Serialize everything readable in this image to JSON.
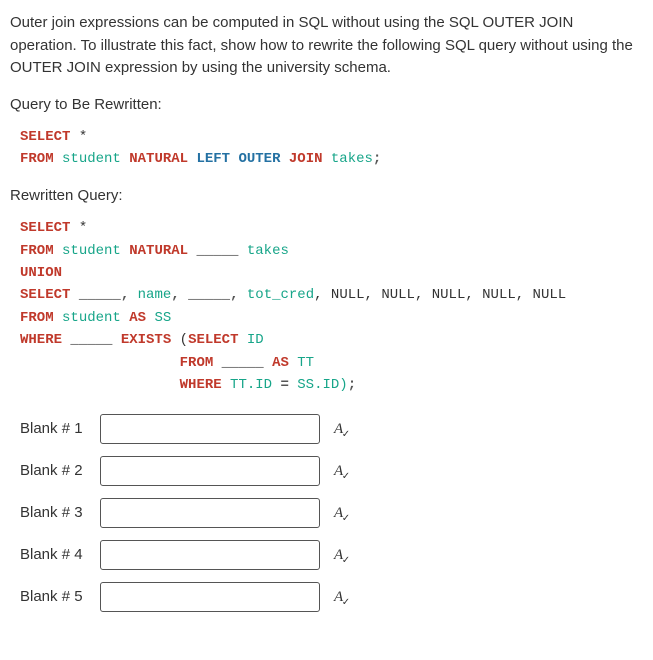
{
  "intro": "Outer join expressions can be computed in SQL without using the SQL OUTER JOIN operation.  To illustrate this fact, show how to rewrite the following SQL query without using the OUTER JOIN expression by using the university schema.",
  "query_label": "Query to Be Rewritten:",
  "rewritten_label": "Rewritten Query:",
  "code1": {
    "select": "SELECT",
    "star": " *",
    "from": "FROM",
    "student": " student ",
    "natural": "NATURAL",
    "left": " LEFT",
    "outer": " OUTER",
    "join": " JOIN",
    "takes": " takes",
    "semi": ";"
  },
  "code2": {
    "select": "SELECT",
    "star": " *",
    "from": "FROM",
    "student": " student ",
    "natural": "NATURAL",
    "blank": " _____ ",
    "takes": "takes",
    "union": "UNION",
    "select2": "SELECT",
    "blank2": " _____",
    "comma": ",",
    "name": " name",
    "comma2": ",",
    "blank3": " _____",
    "comma3": ",",
    "totcred": " tot_cred",
    "nulls": ", NULL, NULL, NULL, NULL, NULL",
    "from2": "FROM",
    "student2": " student ",
    "as": "AS",
    "ss": " SS",
    "where": "WHERE",
    "blank4": " _____ ",
    "exists": "EXISTS",
    "paren": " (",
    "select3": "SELECT",
    "id": " ID",
    "from3": "FROM",
    "blank5": " _____ ",
    "as2": "AS",
    "tt": " TT",
    "where2": "WHERE",
    "ttid": " TT.ID ",
    "eq": "=",
    "ssid": " SS.ID)",
    "semi": ";"
  },
  "blanks": [
    {
      "label": "Blank # 1"
    },
    {
      "label": "Blank # 2"
    },
    {
      "label": "Blank # 3"
    },
    {
      "label": "Blank # 4"
    },
    {
      "label": "Blank # 5"
    }
  ],
  "spellcheck_glyph": "A"
}
